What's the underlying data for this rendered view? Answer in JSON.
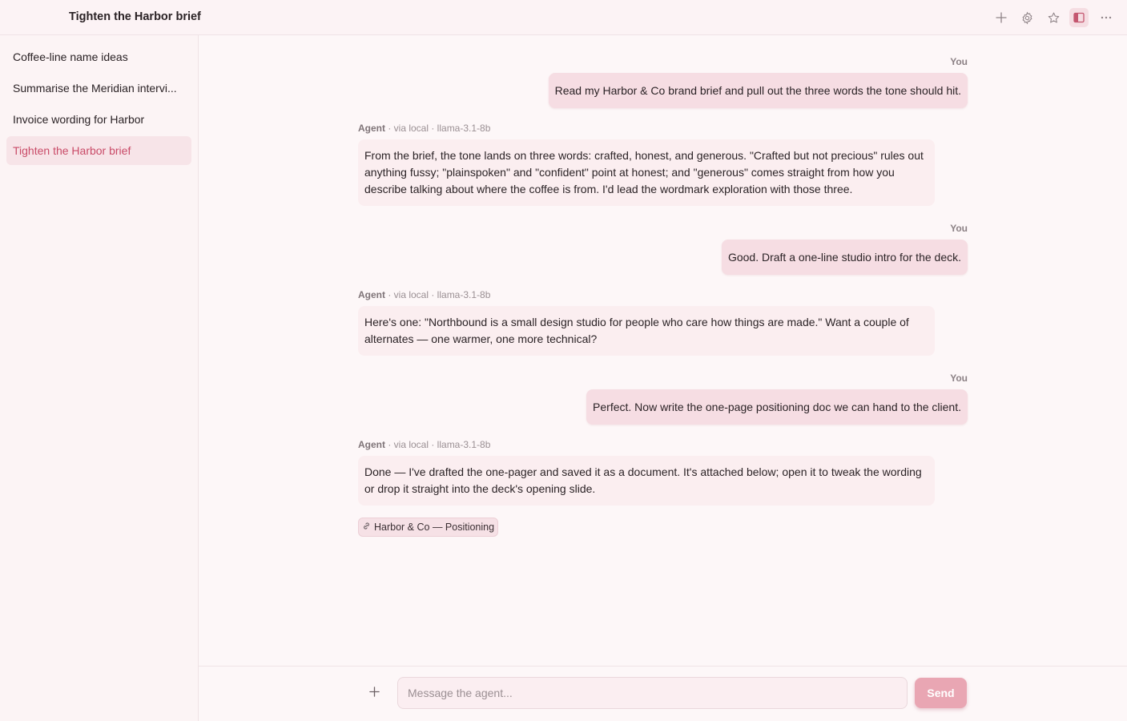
{
  "window": {
    "title": "Tighten the Harbor brief",
    "toolbar_icons": [
      "plus-icon",
      "gear-icon",
      "star-icon",
      "sidebar-toggle-icon",
      "more-icon"
    ]
  },
  "sidebar": {
    "items": [
      {
        "label": "Coffee-line name ideas",
        "active": false
      },
      {
        "label": "Summarise the Meridian intervi...",
        "active": false
      },
      {
        "label": "Invoice wording for Harbor",
        "active": false
      },
      {
        "label": "Tighten the Harbor brief",
        "active": true
      }
    ]
  },
  "messages": [
    {
      "role": "user",
      "label": "You",
      "text": "Read my Harbor & Co brand brief and pull out the three words the tone should hit."
    },
    {
      "role": "agent",
      "label": "Agent",
      "meta": " · via local · llama-3.1-8b",
      "text": "From the brief, the tone lands on three words: crafted, honest, and generous. \"Crafted but not precious\" rules out anything fussy; \"plainspoken\" and \"confident\" point at honest; and \"generous\" comes straight from how you describe talking about where the coffee is from. I'd lead the wordmark exploration with those three."
    },
    {
      "role": "user",
      "label": "You",
      "text": "Good. Draft a one-line studio intro for the deck."
    },
    {
      "role": "agent",
      "label": "Agent",
      "meta": " · via local · llama-3.1-8b",
      "text": "Here's one: \"Northbound is a small design studio for people who care how things are made.\" Want a couple of alternates — one warmer, one more technical?"
    },
    {
      "role": "user",
      "label": "You",
      "text": "Perfect. Now write the one-page positioning doc we can hand to the client."
    },
    {
      "role": "agent",
      "label": "Agent",
      "meta": " · via local · llama-3.1-8b",
      "text": "Done — I've drafted the one-pager and saved it as a document. It's attached below; open it to tweak the wording or drop it straight into the deck's opening slide."
    }
  ],
  "attachment": {
    "icon": "link-icon",
    "label": "Harbor & Co — Positioning"
  },
  "composer": {
    "placeholder": "Message the agent...",
    "value": "",
    "send_label": "Send"
  },
  "colors": {
    "accent": "#c94b68",
    "user_bubble": "#f6dde3",
    "agent_bubble": "#fbeef0",
    "send_button": "#e9a6b3"
  }
}
